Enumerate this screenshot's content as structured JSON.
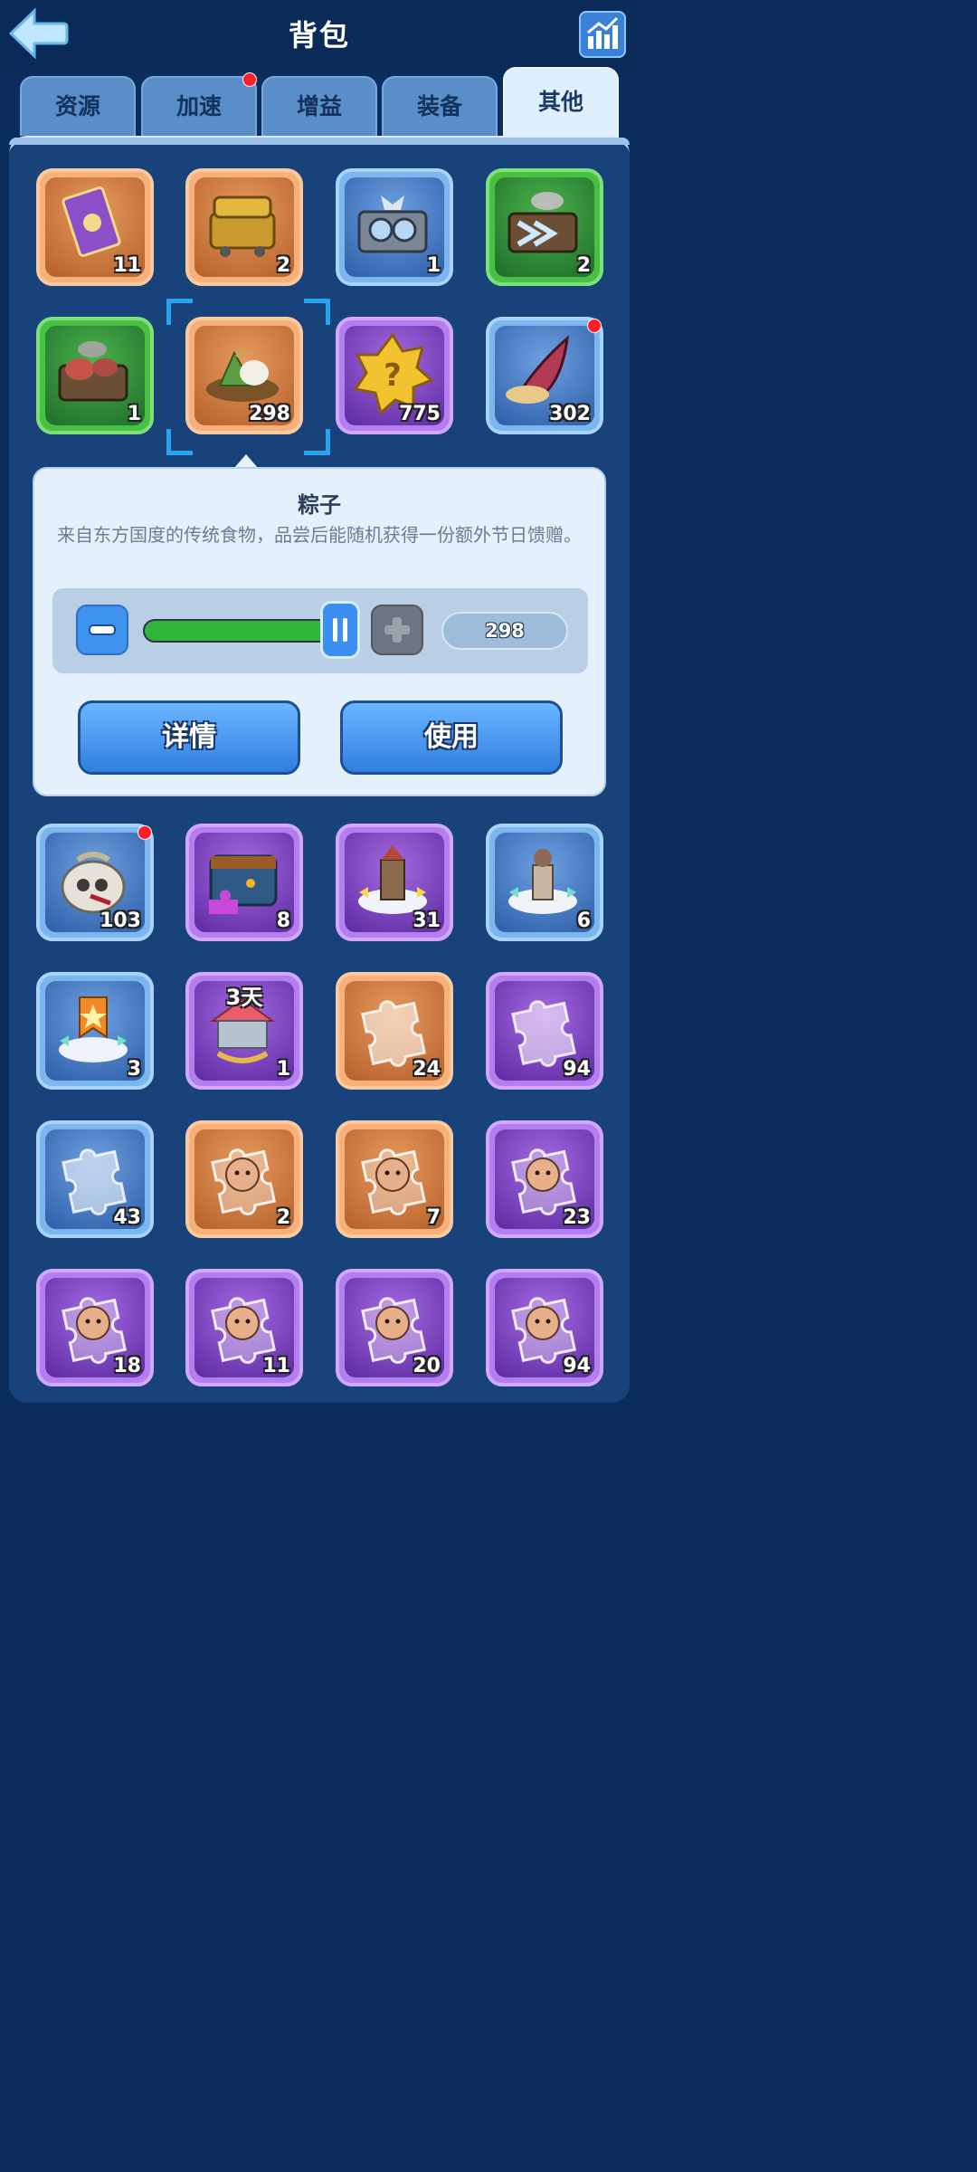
{
  "header": {
    "title": "背包",
    "back_icon": "back-arrow-icon",
    "stats_icon": "bar-chart-icon"
  },
  "tabs": [
    {
      "label": "资源",
      "active": false,
      "notify": false
    },
    {
      "label": "加速",
      "active": false,
      "notify": true
    },
    {
      "label": "增益",
      "active": false,
      "notify": false
    },
    {
      "label": "装备",
      "active": false,
      "notify": false
    },
    {
      "label": "其他",
      "active": true,
      "notify": false
    }
  ],
  "rows_above": [
    [
      {
        "name": "book",
        "count": "11",
        "rarity": "orange",
        "icon": "purple-book-icon"
      },
      {
        "name": "gold-chest",
        "count": "2",
        "rarity": "orange",
        "icon": "gold-chest-icon"
      },
      {
        "name": "gear-chest",
        "count": "1",
        "rarity": "blue",
        "icon": "gear-chest-icon"
      },
      {
        "name": "green-chest",
        "count": "2",
        "rarity": "green",
        "icon": "chevron-chest-icon"
      }
    ],
    [
      {
        "name": "meat-chest",
        "count": "1",
        "rarity": "green",
        "icon": "meat-chest-icon"
      },
      {
        "name": "zongzi",
        "count": "298",
        "rarity": "orange",
        "icon": "zongzi-icon",
        "selected": true
      },
      {
        "name": "mystery-badge",
        "count": "775",
        "rarity": "purple",
        "icon": "question-badge-icon"
      },
      {
        "name": "horn",
        "count": "302",
        "rarity": "blue",
        "icon": "horn-icon",
        "notify": true
      }
    ]
  ],
  "popup": {
    "title": "粽子",
    "description": "来自东方国度的传统食物，品尝后能随机获得一份额外节日馈赠。",
    "quantity": "298",
    "slider_fraction": 1.0,
    "detail_label": "详情",
    "use_label": "使用"
  },
  "rows_below": [
    [
      {
        "name": "skull-sack",
        "count": "103",
        "rarity": "blue",
        "icon": "skull-sack-icon",
        "notify": true
      },
      {
        "name": "puzzle-chest",
        "count": "8",
        "rarity": "purple",
        "icon": "puzzle-chest-icon"
      },
      {
        "name": "tower-relocate",
        "count": "31",
        "rarity": "purple",
        "icon": "tower-icon"
      },
      {
        "name": "statue-relocate",
        "count": "6",
        "rarity": "blue",
        "icon": "statue-icon"
      }
    ],
    [
      {
        "name": "banner-relocate",
        "count": "3",
        "rarity": "blue",
        "icon": "star-banner-icon"
      },
      {
        "name": "carousel-skin",
        "count": "1",
        "rarity": "purple",
        "icon": "carousel-icon",
        "badge": "3天"
      },
      {
        "name": "orange-puzzle",
        "count": "24",
        "rarity": "orange",
        "icon": "puzzle-piece-icon"
      },
      {
        "name": "purple-puzzle",
        "count": "94",
        "rarity": "purple",
        "icon": "puzzle-piece-icon"
      }
    ],
    [
      {
        "name": "blue-puzzle",
        "count": "43",
        "rarity": "blue",
        "icon": "puzzle-piece-icon"
      },
      {
        "name": "hero-puzzle-miner",
        "count": "2",
        "rarity": "orange",
        "icon": "hero-puzzle-icon"
      },
      {
        "name": "hero-puzzle-girl",
        "count": "7",
        "rarity": "orange",
        "icon": "hero-puzzle-icon"
      },
      {
        "name": "hero-puzzle-doctor",
        "count": "23",
        "rarity": "purple",
        "icon": "hero-puzzle-icon"
      }
    ],
    [
      {
        "name": "hero-puzzle-turban",
        "count": "18",
        "rarity": "purple",
        "icon": "hero-puzzle-icon"
      },
      {
        "name": "hero-puzzle-braid",
        "count": "11",
        "rarity": "purple",
        "icon": "hero-puzzle-icon"
      },
      {
        "name": "hero-puzzle-redhair",
        "count": "20",
        "rarity": "purple",
        "icon": "hero-puzzle-icon"
      },
      {
        "name": "hero-puzzle-beard",
        "count": "94",
        "rarity": "purple",
        "icon": "hero-puzzle-icon"
      }
    ]
  ],
  "colors": {
    "background": "#0b2d5e",
    "panel": "#17427a",
    "accent_blue": "#3b8ff0",
    "progress_green": "#2fb53a",
    "notify_red": "#ff1f2b"
  }
}
